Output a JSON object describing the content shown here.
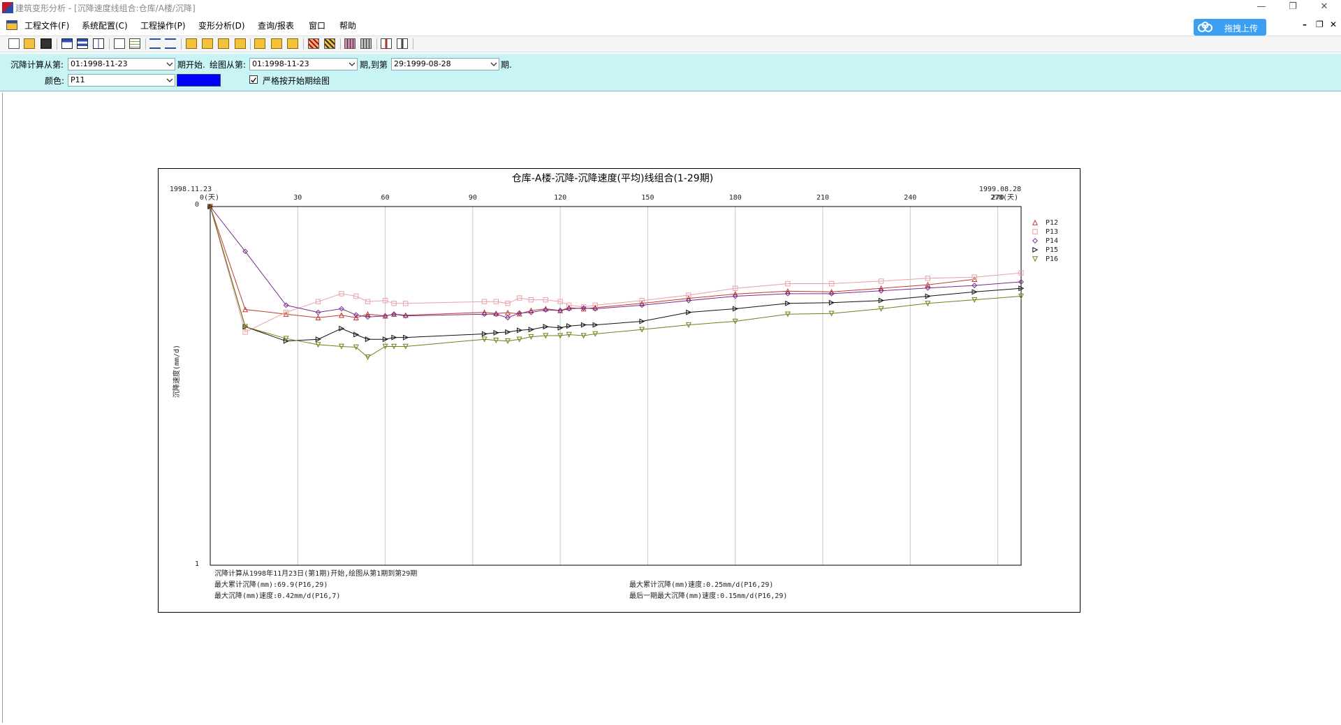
{
  "window": {
    "title": "建筑变形分析 - [沉降速度线组合:仓库/A楼/沉降]",
    "controls": [
      "minimize",
      "restore",
      "close"
    ]
  },
  "menu": {
    "items": [
      "工程文件(F)",
      "系统配置(C)",
      "工程操作(P)",
      "变形分析(D)",
      "查询/报表",
      "窗口",
      "帮助"
    ],
    "upload_label": "拖拽上传"
  },
  "toolbar": {
    "icons": [
      "new-icon",
      "open-icon",
      "save-icon",
      "cascade-icon",
      "tile-horizontal-icon",
      "tile-vertical-icon",
      "edit-icon",
      "table-icon",
      "split-h-icon",
      "split-v-icon",
      "chart1-icon",
      "chart2-icon",
      "chart3-icon",
      "chart4-icon",
      "envelope1-icon",
      "envelope2-icon",
      "envelope3-icon",
      "grid1-icon",
      "grid2-icon",
      "grid3-icon",
      "grid4-icon",
      "report1-icon",
      "report2-icon"
    ]
  },
  "params": {
    "calc_from_label": "沉降计算从第:",
    "calc_from_value": "01:1998-11-23",
    "period_start_label": "期开始.",
    "plot_from_label": "绘图从第:",
    "plot_from_value": "01:1998-11-23",
    "period_to_label": "期,到第",
    "plot_to_value": "29:1999-08-28",
    "period_end_label": "期.",
    "color_label": "颜色:",
    "color_value": "P11",
    "swatch_color": "#0000ff",
    "strict_label": "严格按开始期绘图",
    "strict_checked": true
  },
  "chart_data": {
    "type": "line",
    "title": "仓库-A楼-沉降-沉降速度(平均)线组合(1-29期)",
    "ylabel": "沉降速度(mm/d)",
    "x_start_date": "1998.11.23",
    "x_end_date": "1999.08.28",
    "x_unit_start": "0(天)",
    "x_unit_end": "278(天)",
    "xlim": [
      0,
      278
    ],
    "x_ticks": [
      30,
      60,
      90,
      120,
      150,
      180,
      210,
      240,
      270
    ],
    "ylim": [
      0,
      1
    ],
    "y_ticks": [
      "0",
      "1"
    ],
    "y_inverted": true,
    "grid": "vertical",
    "legend": "top-right",
    "series": [
      {
        "name": "P12",
        "color": "#c0392b",
        "marker": "triangle-up",
        "x": [
          0,
          12,
          26,
          37,
          45,
          50,
          54,
          60,
          63,
          67,
          94,
          98,
          102,
          106,
          110,
          115,
          120,
          123,
          128,
          132,
          148,
          164,
          180,
          198,
          213,
          230,
          246,
          262
        ],
        "values": [
          0,
          0.287,
          0.3,
          0.31,
          0.303,
          0.31,
          0.3,
          0.305,
          0.3,
          0.303,
          0.295,
          0.298,
          0.296,
          0.299,
          0.29,
          0.285,
          0.29,
          0.282,
          0.285,
          0.282,
          0.27,
          0.256,
          0.244,
          0.236,
          0.238,
          0.228,
          0.218,
          0.203
        ]
      },
      {
        "name": "P13",
        "color": "#e8a0a8",
        "marker": "square",
        "x": [
          0,
          12,
          26,
          37,
          45,
          50,
          54,
          60,
          63,
          67,
          94,
          98,
          102,
          106,
          110,
          115,
          120,
          123,
          128,
          132,
          148,
          164,
          180,
          198,
          213,
          230,
          246,
          262,
          278
        ],
        "values": [
          0,
          0.35,
          0.295,
          0.265,
          0.243,
          0.25,
          0.265,
          0.262,
          0.27,
          0.27,
          0.265,
          0.265,
          0.27,
          0.255,
          0.26,
          0.26,
          0.265,
          0.275,
          0.28,
          0.275,
          0.262,
          0.247,
          0.228,
          0.215,
          0.215,
          0.208,
          0.2,
          0.197,
          0.185
        ]
      },
      {
        "name": "P14",
        "color": "#7a2a8a",
        "marker": "diamond",
        "x": [
          0,
          12,
          26,
          37,
          45,
          50,
          54,
          60,
          63,
          67,
          94,
          98,
          102,
          106,
          110,
          115,
          120,
          123,
          128,
          132,
          148,
          164,
          180,
          198,
          213,
          230,
          246,
          262,
          278
        ],
        "values": [
          0,
          0.125,
          0.275,
          0.295,
          0.285,
          0.302,
          0.308,
          0.305,
          0.3,
          0.305,
          0.3,
          0.3,
          0.31,
          0.297,
          0.295,
          0.288,
          0.29,
          0.285,
          0.283,
          0.285,
          0.275,
          0.262,
          0.25,
          0.243,
          0.243,
          0.235,
          0.227,
          0.22,
          0.21
        ]
      },
      {
        "name": "P15",
        "color": "#111111",
        "marker": "triangle-right",
        "x": [
          0,
          12,
          26,
          37,
          45,
          50,
          54,
          60,
          63,
          67,
          94,
          98,
          102,
          106,
          110,
          115,
          120,
          123,
          128,
          132,
          148,
          164,
          180,
          198,
          213,
          230,
          246,
          262,
          278
        ],
        "values": [
          0,
          0.335,
          0.375,
          0.37,
          0.34,
          0.357,
          0.37,
          0.37,
          0.365,
          0.365,
          0.355,
          0.352,
          0.35,
          0.345,
          0.343,
          0.335,
          0.338,
          0.333,
          0.33,
          0.33,
          0.32,
          0.295,
          0.285,
          0.27,
          0.268,
          0.262,
          0.25,
          0.238,
          0.228
        ]
      },
      {
        "name": "P16",
        "color": "#7a7a18",
        "marker": "triangle-down",
        "x": [
          0,
          12,
          26,
          37,
          45,
          50,
          54,
          60,
          63,
          67,
          94,
          98,
          102,
          106,
          110,
          115,
          120,
          123,
          128,
          132,
          148,
          164,
          180,
          198,
          213,
          230,
          246,
          262,
          278
        ],
        "values": [
          0,
          0.335,
          0.368,
          0.385,
          0.39,
          0.392,
          0.42,
          0.39,
          0.39,
          0.39,
          0.37,
          0.373,
          0.375,
          0.37,
          0.363,
          0.36,
          0.36,
          0.357,
          0.36,
          0.355,
          0.343,
          0.33,
          0.32,
          0.3,
          0.298,
          0.285,
          0.27,
          0.26,
          0.25
        ]
      }
    ],
    "notes": [
      "沉降计算从1998年11月23日(第1期)开始,绘图从第1期到第29期",
      "最大累计沉降(mm):69.9(P16,29)",
      "最大沉降(mm)速度:0.42mm/d(P16,7)",
      "最大累计沉降(mm)速度:0.25mm/d(P16,29)",
      "最后一期最大沉降(mm)速度:0.15mm/d(P16,29)"
    ]
  }
}
